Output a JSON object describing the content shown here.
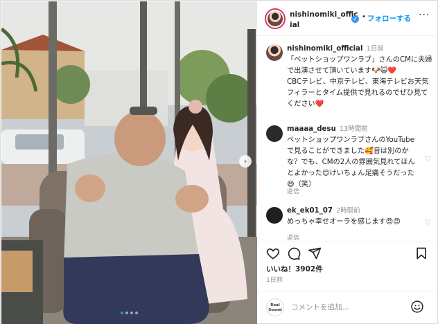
{
  "header": {
    "username": "nishinomiki_official",
    "follow_label": "フォローする",
    "dot": "•",
    "more": "···"
  },
  "caption": {
    "username": "nishinomiki_official",
    "time": "1日前",
    "line1": "「ペットショップワンラブ」さんのCMに夫婦で出演させて頂いています🐶😺❤️",
    "line2": "CBCテレビ、中京テレビ、東海テレビお天気フィラーとタイム提供で見れるのでぜひ見てください❤️"
  },
  "comments": [
    {
      "username": "maaaa_desu",
      "time": "13時間前",
      "text": "ペットショップワンラブさんのYouTubeで見ることができました🥰音は別のかな？でも、CMの2人の雰囲気見れてほんとよかった😊けいちょん足痛そうだった😄（笑）",
      "reply": "返信"
    },
    {
      "username": "ek_ek01_07",
      "time": "2時間前",
      "text": "めっちゃ幸せオーラを感じます😍😍",
      "reply": "返信"
    }
  ],
  "footer": {
    "likes": "いいね！3902件",
    "date": "1日前",
    "comment_placeholder": "コメントを追加...",
    "avatar_label_1": "Real",
    "avatar_label_2": "Sound"
  },
  "colors": {
    "accent": "#0095f6",
    "ring": "#e1306c",
    "verified": "#3897f0",
    "border": "#dbdbdb"
  },
  "carousel": {
    "active_index": 0,
    "total": 4
  }
}
